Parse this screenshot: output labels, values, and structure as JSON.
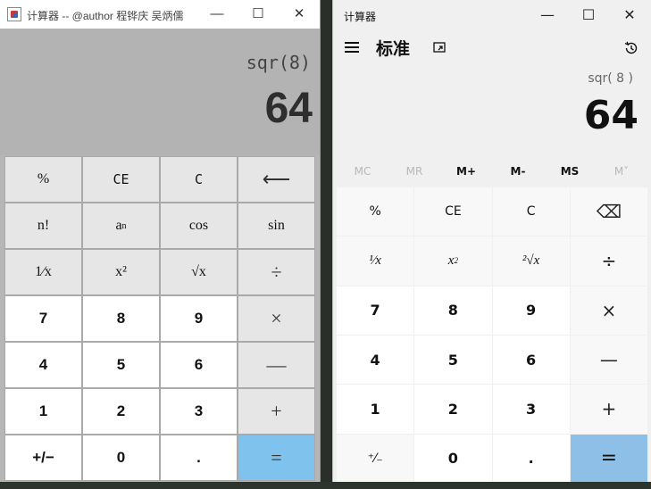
{
  "left": {
    "title": "计算器 -- @author 程铧庆 吴炳儒",
    "window_buttons": {
      "minimize": "—",
      "maximize": "☐",
      "close": "✕"
    },
    "expression": "sqr(8)",
    "result": "64",
    "keys": [
      {
        "label": "%",
        "style": "gray"
      },
      {
        "label": "CE",
        "style": "gray",
        "font": "mono"
      },
      {
        "label": "C",
        "style": "gray",
        "font": "mono"
      },
      {
        "label": "⟵",
        "style": "gray",
        "font": "op"
      },
      {
        "label": "n!",
        "style": "gray"
      },
      {
        "label": "a",
        "sup": "n",
        "style": "gray"
      },
      {
        "label": "cos",
        "style": "gray"
      },
      {
        "label": "sin",
        "style": "gray"
      },
      {
        "label": "1⁄x",
        "style": "gray"
      },
      {
        "label": "x²",
        "style": "gray"
      },
      {
        "label": "√x",
        "style": "gray"
      },
      {
        "label": "÷",
        "style": "gray",
        "font": "op"
      },
      {
        "label": "7",
        "style": "white",
        "font": "num"
      },
      {
        "label": "8",
        "style": "white",
        "font": "num"
      },
      {
        "label": "9",
        "style": "white",
        "font": "num"
      },
      {
        "label": "×",
        "style": "gray",
        "font": "op"
      },
      {
        "label": "4",
        "style": "white",
        "font": "num"
      },
      {
        "label": "5",
        "style": "white",
        "font": "num"
      },
      {
        "label": "6",
        "style": "white",
        "font": "num"
      },
      {
        "label": "—",
        "style": "gray",
        "font": "op"
      },
      {
        "label": "1",
        "style": "white",
        "font": "num"
      },
      {
        "label": "2",
        "style": "white",
        "font": "num"
      },
      {
        "label": "3",
        "style": "white",
        "font": "num"
      },
      {
        "label": "+",
        "style": "gray",
        "font": "op"
      },
      {
        "label": "+/−",
        "style": "white",
        "font": "num"
      },
      {
        "label": "0",
        "style": "white",
        "font": "num"
      },
      {
        "label": ".",
        "style": "white",
        "font": "num"
      },
      {
        "label": "=",
        "style": "blue",
        "font": "op"
      }
    ]
  },
  "right": {
    "title": "计算器",
    "window_buttons": {
      "minimize": "—",
      "maximize": "☐",
      "close": "✕"
    },
    "mode": "标准",
    "expression": "sqr( 8 )",
    "result": "64",
    "memory": [
      {
        "label": "MC",
        "enabled": false
      },
      {
        "label": "MR",
        "enabled": false
      },
      {
        "label": "M+",
        "enabled": true
      },
      {
        "label": "M-",
        "enabled": true
      },
      {
        "label": "MS",
        "enabled": true
      },
      {
        "label": "M˅",
        "enabled": false
      }
    ],
    "keys": [
      {
        "label": "%",
        "cls": ""
      },
      {
        "label": "CE",
        "cls": ""
      },
      {
        "label": "C",
        "cls": ""
      },
      {
        "label": "⌫",
        "cls": "op",
        "icon": "backspace-icon"
      },
      {
        "label": "¹⁄x",
        "cls": "fn"
      },
      {
        "label": "x",
        "sup": "2",
        "cls": "fn"
      },
      {
        "label": "²√x",
        "cls": "fn"
      },
      {
        "label": "÷",
        "cls": "op"
      },
      {
        "label": "7",
        "cls": "num"
      },
      {
        "label": "8",
        "cls": "num"
      },
      {
        "label": "9",
        "cls": "num"
      },
      {
        "label": "×",
        "cls": "op"
      },
      {
        "label": "4",
        "cls": "num"
      },
      {
        "label": "5",
        "cls": "num"
      },
      {
        "label": "6",
        "cls": "num"
      },
      {
        "label": "—",
        "cls": "op"
      },
      {
        "label": "1",
        "cls": "num"
      },
      {
        "label": "2",
        "cls": "num"
      },
      {
        "label": "3",
        "cls": "num"
      },
      {
        "label": "+",
        "cls": "op"
      },
      {
        "label": "⁺⁄₋",
        "cls": ""
      },
      {
        "label": "0",
        "cls": "num"
      },
      {
        "label": ".",
        "cls": "num"
      },
      {
        "label": "=",
        "cls": "eq"
      }
    ]
  },
  "colors": {
    "left_equals": "#7fc2ee",
    "right_equals": "#8ebfe6"
  }
}
